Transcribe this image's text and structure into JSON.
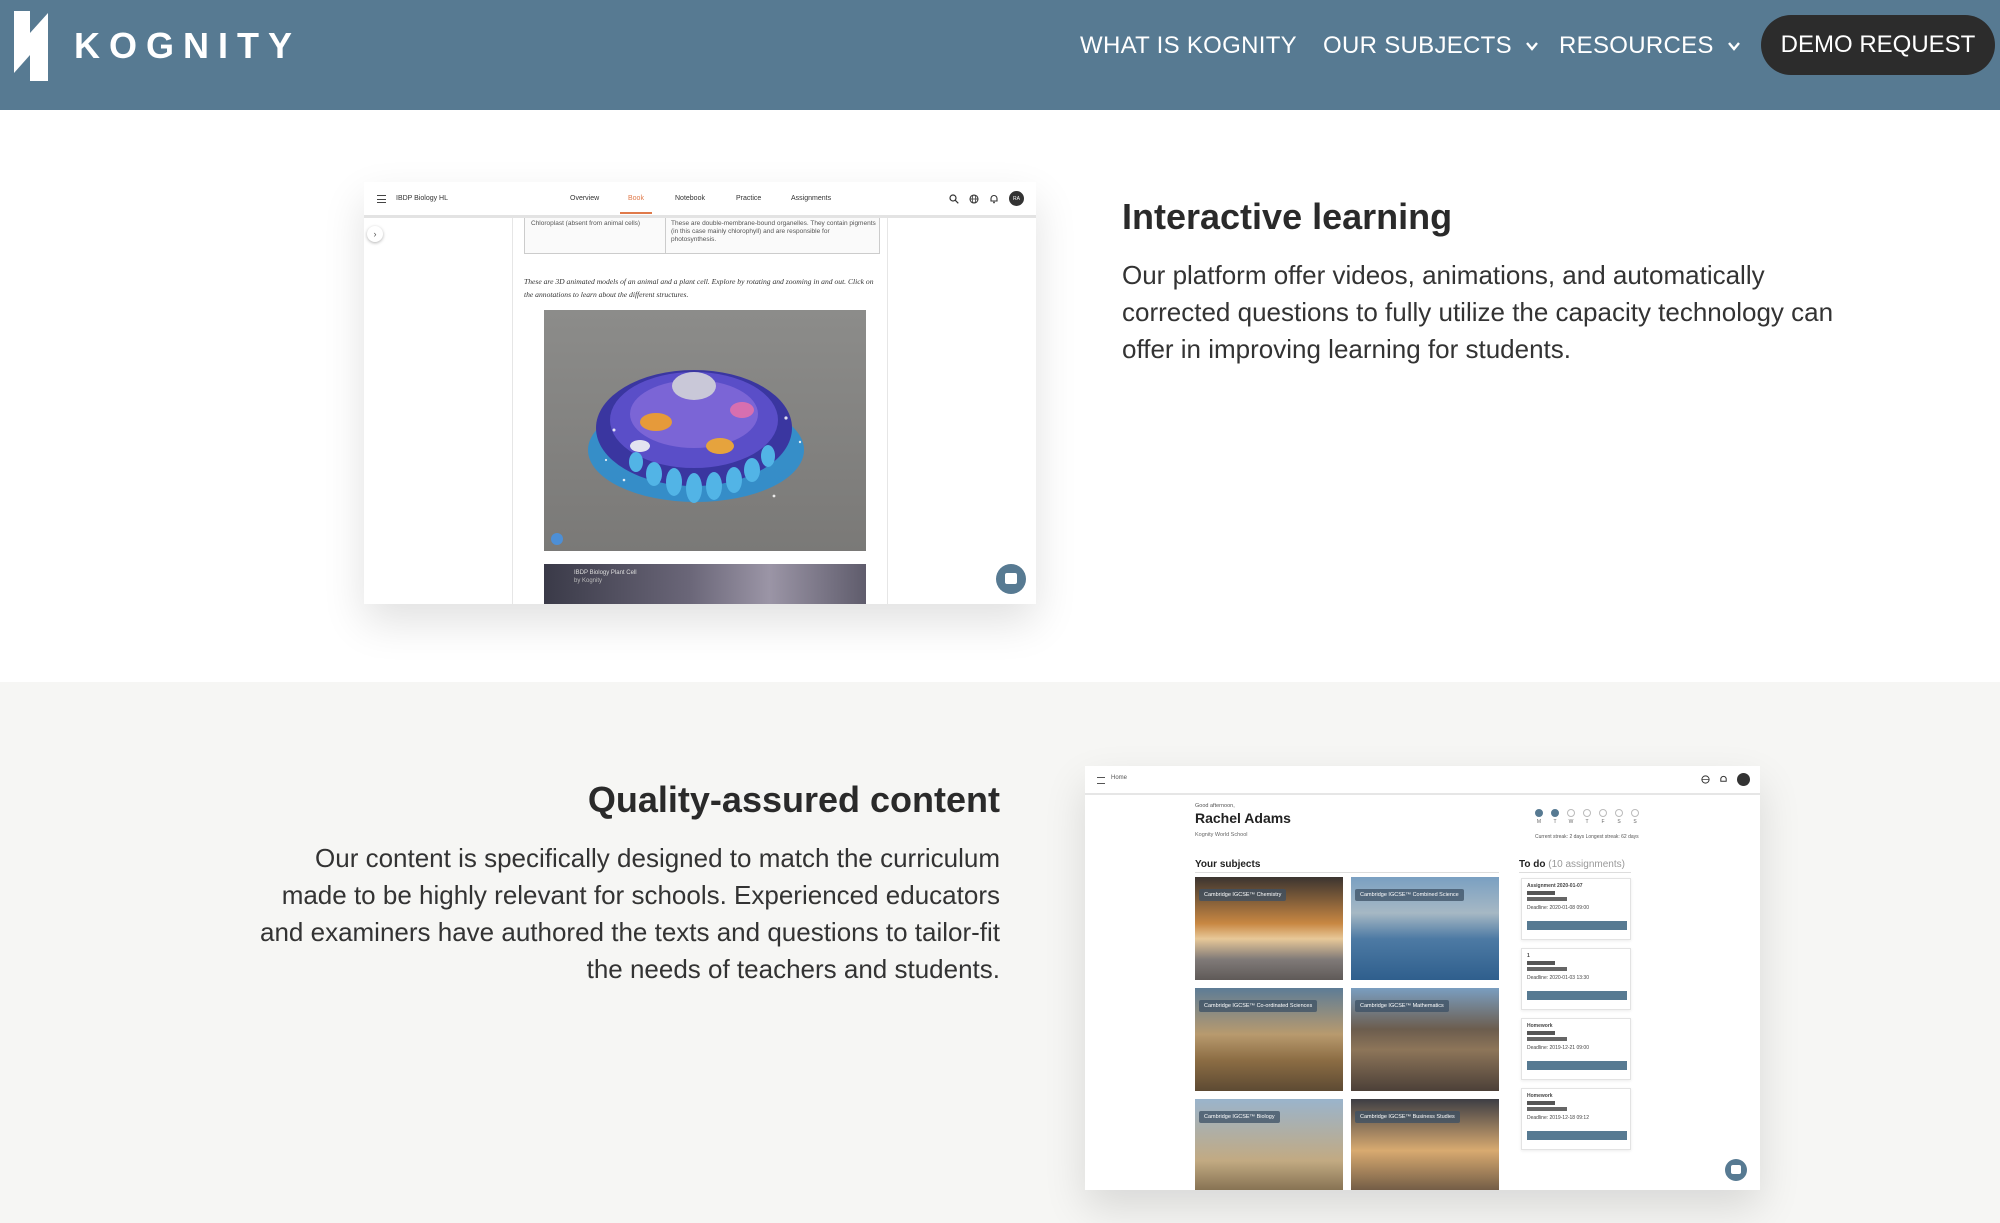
{
  "header": {
    "brand": "KOGNITY",
    "nav": {
      "what": "WHAT IS KOGNITY",
      "subjects": "OUR SUBJECTS",
      "resources": "RESOURCES"
    },
    "demo_button": "DEMO REQUEST",
    "colors": {
      "bar": "#577a92",
      "button": "#2c2c2c"
    }
  },
  "section_interactive": {
    "title": "Interactive learning",
    "body": "Our platform offer videos, animations, and automatically corrected questions to fully utilize the capacity technology can offer in improving learning for students.",
    "screenshot": {
      "course": "IBDP Biology HL",
      "tabs": [
        "Overview",
        "Book",
        "Notebook",
        "Practice",
        "Assignments"
      ],
      "active_tab": "Book",
      "avatar": "RA",
      "table_cell_left": "Chloroplast (absent from animal cells)",
      "table_cell_right": "These are double-membrane-bound organelles. They contain pigments (in this case mainly chlorophyll) and are responsible for photosynthesis.",
      "caption": "These are 3D animated models of an animal and a plant cell. Explore by rotating and zooming in and out. Click on the annotations to learn about the different structures.",
      "video_title": "IBDP Biology Plant Cell",
      "video_by": "by Kognity"
    }
  },
  "section_quality": {
    "title": "Quality-assured content",
    "body": "Our content is specifically designed to match the curriculum made to be highly relevant for schools. Experienced educators and examiners have authored the texts and questions to tailor-fit the needs of teachers and students.",
    "screenshot": {
      "home": "Home",
      "greeting": "Good afternoon,",
      "name": "Rachel Adams",
      "school": "Kognity World School",
      "week_days": [
        "M",
        "T",
        "W",
        "T",
        "F",
        "S",
        "S"
      ],
      "streak": "Current streak: 2 days  Longest streak: 62 days",
      "subjects_heading": "Your subjects",
      "todo_heading": "To do",
      "todo_count": "(10 assignments)",
      "subjects": [
        "Cambridge IGCSE™ Chemistry",
        "Cambridge IGCSE™ Combined Science",
        "Cambridge IGCSE™ Co-ordinated Sciences",
        "Cambridge IGCSE™ Mathematics",
        "Cambridge IGCSE™ Biology",
        "Cambridge IGCSE™ Business Studies"
      ],
      "todos": [
        {
          "title": "Assignment 2020-01-07",
          "deadline": "Deadline: 2020-01-08 09:00"
        },
        {
          "title": "1",
          "deadline": "Deadline: 2020-01-03 13:30"
        },
        {
          "title": "Homework",
          "deadline": "Deadline: 2019-12-21 09:00"
        },
        {
          "title": "Homework",
          "deadline": "Deadline: 2019-12-18 09:12"
        }
      ]
    }
  }
}
